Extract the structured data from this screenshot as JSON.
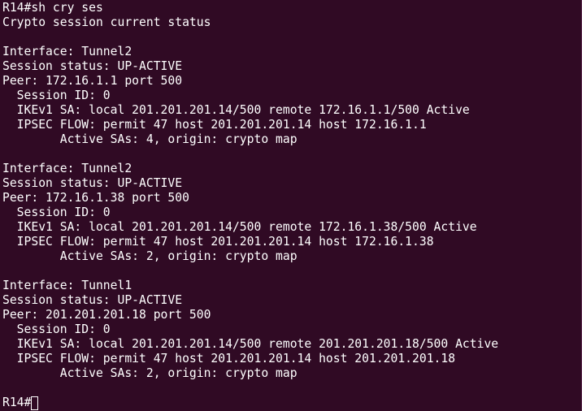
{
  "terminal": {
    "lines": [
      "R14#sh cry ses",
      "Crypto session current status",
      "",
      "Interface: Tunnel2",
      "Session status: UP-ACTIVE",
      "Peer: 172.16.1.1 port 500",
      "  Session ID: 0",
      "  IKEv1 SA: local 201.201.201.14/500 remote 172.16.1.1/500 Active",
      "  IPSEC FLOW: permit 47 host 201.201.201.14 host 172.16.1.1",
      "        Active SAs: 4, origin: crypto map",
      "",
      "Interface: Tunnel2",
      "Session status: UP-ACTIVE",
      "Peer: 172.16.1.38 port 500",
      "  Session ID: 0",
      "  IKEv1 SA: local 201.201.201.14/500 remote 172.16.1.38/500 Active",
      "  IPSEC FLOW: permit 47 host 201.201.201.14 host 172.16.1.38",
      "        Active SAs: 2, origin: crypto map",
      "",
      "Interface: Tunnel1",
      "Session status: UP-ACTIVE",
      "Peer: 201.201.201.18 port 500",
      "  Session ID: 0",
      "  IKEv1 SA: local 201.201.201.14/500 remote 201.201.201.18/500 Active",
      "  IPSEC FLOW: permit 47 host 201.201.201.14 host 201.201.201.18",
      "        Active SAs: 2, origin: crypto map",
      ""
    ],
    "prompt": "R14#"
  },
  "colors": {
    "background": "#300a24",
    "foreground": "#ffffff"
  }
}
